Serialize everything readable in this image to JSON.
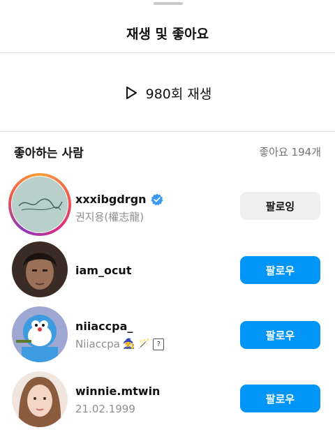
{
  "sheet": {
    "title": "재생 및 좋아요"
  },
  "plays": {
    "label": "980회 재생",
    "icon": "play-icon"
  },
  "likes": {
    "section_title": "좋아하는 사람",
    "count_label": "좋아요 194개"
  },
  "users": [
    {
      "username": "xxxibgdrgn",
      "subname": "권지용(權志龍)",
      "verified": true,
      "has_story": true,
      "button": "팔로잉"
    },
    {
      "username": "iam_ocut",
      "subname": "",
      "verified": false,
      "has_story": false,
      "button": "팔로우"
    },
    {
      "username": "niiaccpa_",
      "subname": "Niiaccpa",
      "subname_suffix": "🧙 🪄",
      "subname_box": "?",
      "verified": false,
      "has_story": false,
      "button": "팔로우"
    },
    {
      "username": "winnie.mtwin",
      "subname": "21.02.1999",
      "verified": false,
      "has_story": false,
      "button": "팔로우"
    }
  ],
  "colors": {
    "follow": "#0095f6",
    "following": "#efefef",
    "verified": "#3897f0"
  }
}
